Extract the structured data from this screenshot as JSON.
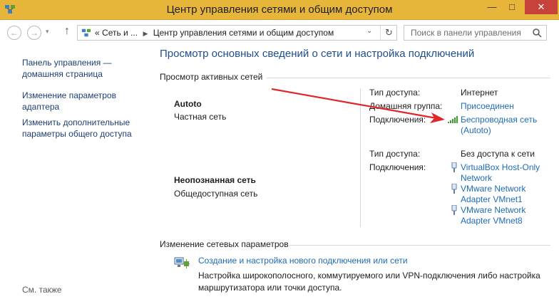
{
  "window": {
    "title": "Центр управления сетями и общим доступом",
    "min_glyph": "—",
    "max_glyph": "□",
    "close_glyph": "✕"
  },
  "nav": {
    "back_glyph": "←",
    "forward_glyph": "→",
    "history_glyph": "▾",
    "up_glyph": "↑",
    "breadcrumb_prefix": "«",
    "breadcrumb_1": "Сеть и ...",
    "breadcrumb_sep": "▶",
    "breadcrumb_2": "Центр управления сетями и общим доступом",
    "dropdown_glyph": "⌄",
    "refresh_glyph": "↻",
    "search_placeholder": "Поиск в панели управления"
  },
  "sidebar": {
    "items": [
      {
        "label": "Панель управления — домашняя страница"
      },
      {
        "label": "Изменение параметров адаптера"
      },
      {
        "label": "Изменить дополнительные параметры общего доступа"
      }
    ],
    "see_also": "См. также"
  },
  "main": {
    "heading": "Просмотр основных сведений о сети и настройка подключений",
    "active_networks_title": "Просмотр активных сетей",
    "networks": [
      {
        "name": "Autoto",
        "type": "Частная сеть",
        "access_label": "Тип доступа:",
        "access_value": "Интернет",
        "homegroup_label": "Домашняя группа:",
        "homegroup_value": "Присоединен",
        "connections_label": "Подключения:",
        "connections": [
          {
            "line1": "Беспроводная сеть",
            "line2": "(Autoto)",
            "icon": "wifi-signal-icon"
          }
        ]
      },
      {
        "name": "Неопознанная сеть",
        "type": "Общедоступная сеть",
        "access_label": "Тип доступа:",
        "access_value": "Без доступа к сети",
        "connections_label": "Подключения:",
        "connections": [
          {
            "line1": "VirtualBox Host-Only",
            "line2": "Network",
            "icon": "ethernet-icon"
          },
          {
            "line1": "VMware Network",
            "line2": "Adapter VMnet1",
            "icon": "ethernet-icon"
          },
          {
            "line1": "VMware Network",
            "line2": "Adapter VMnet8",
            "icon": "ethernet-icon"
          }
        ]
      }
    ],
    "change_settings_title": "Изменение сетевых параметров",
    "task": {
      "link": "Создание и настройка нового подключения или сети",
      "description": "Настройка широкополосного, коммутируемого или VPN-подключения либо настройка маршрутизатора или точки доступа."
    }
  },
  "colors": {
    "titlebar": "#e7b53a",
    "link": "#1e6bb8",
    "heading": "#1e4e8c",
    "annotation_arrow": "#e0262b"
  }
}
